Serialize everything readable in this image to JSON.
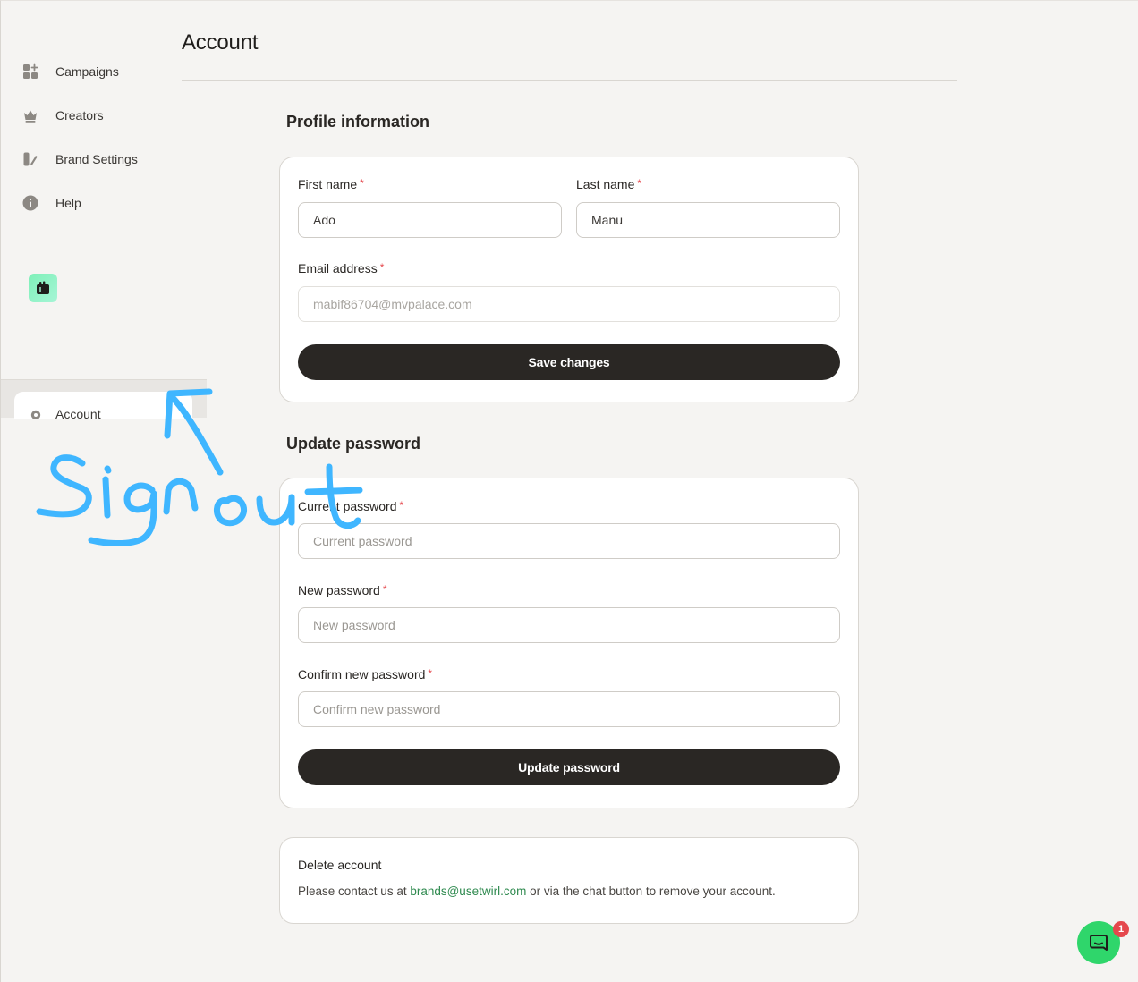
{
  "page": {
    "title": "Account"
  },
  "sidebar": {
    "items": [
      {
        "label": "Campaigns",
        "icon": "grid-plus-icon"
      },
      {
        "label": "Creators",
        "icon": "crown-icon"
      },
      {
        "label": "Brand Settings",
        "icon": "palette-icon"
      },
      {
        "label": "Help",
        "icon": "info-icon"
      }
    ],
    "account_label": "Account"
  },
  "profile": {
    "section_title": "Profile information",
    "first_name_label": "First name",
    "first_name_value": "Ado",
    "last_name_label": "Last name",
    "last_name_value": "Manu",
    "email_label": "Email address",
    "email_value": "mabif86704@mvpalace.com",
    "required_mark": "*",
    "save_label": "Save changes"
  },
  "password": {
    "section_title": "Update password",
    "current_label": "Current password",
    "current_placeholder": "Current password",
    "new_label": "New password",
    "new_placeholder": "New password",
    "confirm_label": "Confirm new password",
    "confirm_placeholder": "Confirm new password",
    "update_label": "Update password"
  },
  "delete_account": {
    "title": "Delete account",
    "text_before": "Please contact us at ",
    "email": "brands@usetwirl.com",
    "text_after": " or via the chat button to remove your account."
  },
  "chat": {
    "badge_count": "1",
    "icon": "chat-icon",
    "color": "#2fd66b"
  },
  "annotation": {
    "text": "Signout",
    "color": "#3fb6ff"
  }
}
